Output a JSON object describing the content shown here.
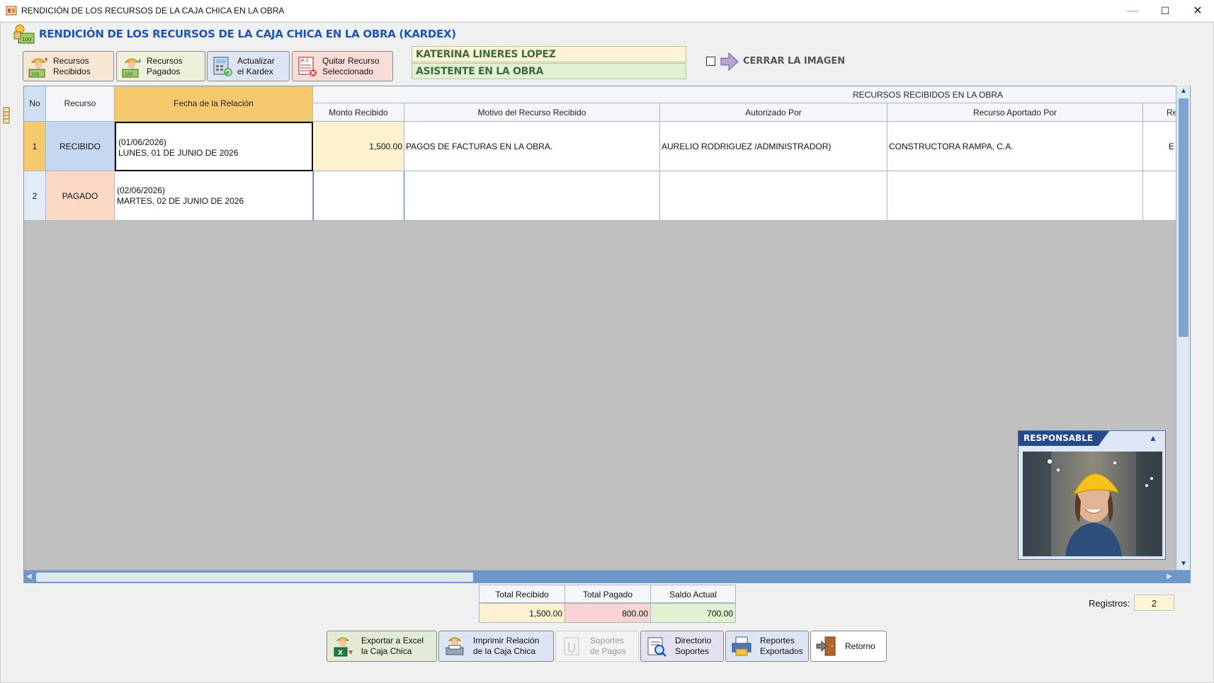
{
  "window": {
    "title": "RENDICIÓN DE LOS RECURSOS DE LA CAJA CHICA EN LA OBRA",
    "minimize": "—",
    "maximize": "☐",
    "close": "✕"
  },
  "header": {
    "title": "RENDICIÓN DE LOS RECURSOS DE LA CAJA CHICA EN LA OBRA (KARDEX)"
  },
  "toolbar": [
    {
      "line1": "Recursos",
      "line2": "Recibidos",
      "icon": "worker-money-in-icon"
    },
    {
      "line1": "Recursos",
      "line2": "Pagados",
      "icon": "worker-money-out-icon"
    },
    {
      "line1": "Actualizar",
      "line2": "el Kardex",
      "icon": "refresh-calculator-icon"
    },
    {
      "line1": "Quitar Recurso",
      "line2": "Seleccionado",
      "icon": "delete-record-icon"
    }
  ],
  "user": {
    "name": "KATERINA LINERES LOPEZ",
    "role": "ASISTENTE EN LA OBRA"
  },
  "close_image": {
    "checked": false,
    "label": "CERRAR LA IMAGEN"
  },
  "grid": {
    "group_header": "RECURSOS RECIBIDOS EN LA OBRA",
    "columns": {
      "no": "No",
      "recurso": "Recurso",
      "fecha": "Fecha de la Relación",
      "monto": "Monto Recibido",
      "motivo": "Motivo del Recurso Recibido",
      "autorizado": "Autorizado Por",
      "aportado": "Recurso Aportado Por",
      "cut": "Re"
    },
    "rows": [
      {
        "no": "1",
        "recurso": "RECIBIDO",
        "fecha1": "(01/06/2026)",
        "fecha2": "LUNES, 01 DE JUNIO DE 2026",
        "monto": "1,500.00",
        "motivo": "PAGOS DE FACTURAS EN LA OBRA.",
        "autorizado": "AURELIO RODRIGUEZ /ADMINISTRADOR)",
        "aportado": "CONSTRUCTORA  RAMPA, C.A.",
        "cut": "E"
      },
      {
        "no": "2",
        "recurso": "PAGADO",
        "fecha1": "(02/06/2026)",
        "fecha2": "MARTES, 02 DE JUNIO DE 2026",
        "monto": "",
        "motivo": "",
        "autorizado": "",
        "aportado": "",
        "cut": ""
      }
    ]
  },
  "responsable": {
    "label": "RESPONSABLE"
  },
  "totals": {
    "recibido_label": "Total Recibido",
    "pagado_label": "Total Pagado",
    "saldo_label": "Saldo Actual",
    "recibido": "1,500.00",
    "pagado": "800.00",
    "saldo": "700.00"
  },
  "registros": {
    "label": "Registros:",
    "value": "2"
  },
  "bottom_buttons": [
    {
      "line1": "Exportar a Excel",
      "line2": "la Caja Chica",
      "icon": "excel-export-icon",
      "disabled": false
    },
    {
      "line1": "Imprimir Relación",
      "line2": "de la Caja Chica",
      "icon": "print-report-icon",
      "disabled": false
    },
    {
      "line1": "Soportes",
      "line2": "de Pagos",
      "icon": "attachment-icon",
      "disabled": true
    },
    {
      "line1": "Directorio",
      "line2": "Soportes",
      "icon": "folder-search-icon",
      "disabled": false
    },
    {
      "line1": "Reportes",
      "line2": "Exportados",
      "icon": "printer-icon",
      "disabled": false
    },
    {
      "line1": "Retorno",
      "line2": "",
      "icon": "exit-door-icon",
      "disabled": false
    }
  ],
  "colors": {
    "accent_blue": "#1d56b8",
    "user_text": "#3e6b3e",
    "selected_header": "#f7c96e",
    "recibido_cell": "#c6d7f1",
    "pagado_cell": "#fbd9c4",
    "total_recibido_bg": "#fdf1cf",
    "total_pagado_bg": "#f9d4d4",
    "saldo_bg": "#e2efd0"
  }
}
